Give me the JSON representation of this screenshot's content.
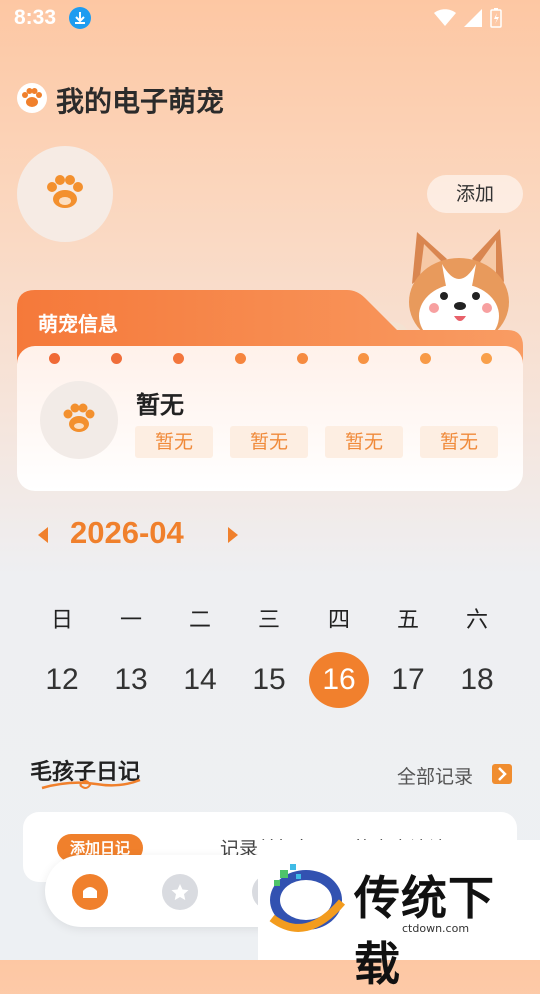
{
  "status_bar": {
    "time": "8:33"
  },
  "header": {
    "title": "我的电子萌宠"
  },
  "pet_section": {
    "add_label": "添加"
  },
  "info_card": {
    "tab_label": "萌宠信息",
    "name": "暂无",
    "tags": [
      "暂无",
      "暂无",
      "暂无",
      "暂无"
    ]
  },
  "calendar": {
    "month": "2026-04",
    "weekdays": [
      "日",
      "一",
      "二",
      "三",
      "四",
      "五",
      "六"
    ],
    "days": [
      "12",
      "13",
      "14",
      "15",
      "16",
      "17",
      "18"
    ],
    "selected_day": "16"
  },
  "diary": {
    "title": "毛孩子日记",
    "view_all": "全部记录",
    "add_label": "添加日记",
    "hint": "记录美好每一天的点点滴滴"
  },
  "colors": {
    "accent": "#f0802c",
    "tag_bg": "#fdeee2"
  },
  "watermark": {
    "brand": "传统下载",
    "url": "ctdown.com"
  }
}
